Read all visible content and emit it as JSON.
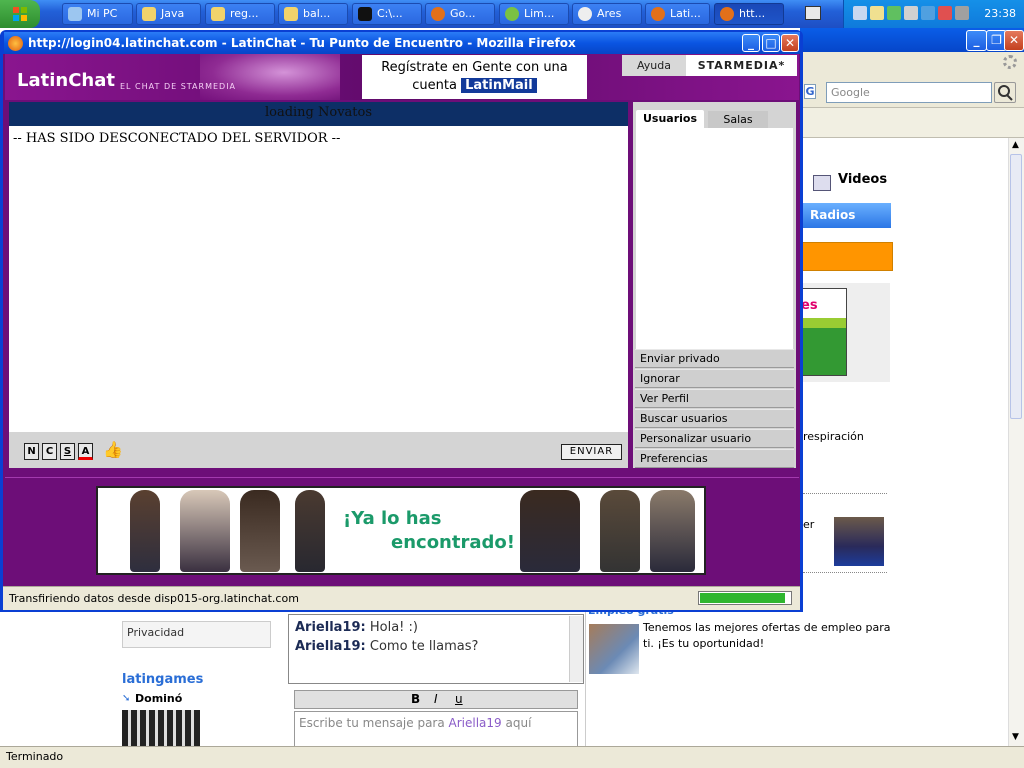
{
  "taskbar": {
    "items": [
      {
        "label": "Mi PC"
      },
      {
        "label": "Java"
      },
      {
        "label": "reg..."
      },
      {
        "label": "bal..."
      },
      {
        "label": "C:\\..."
      },
      {
        "label": "Go..."
      },
      {
        "label": "Lim..."
      },
      {
        "label": "Ares"
      },
      {
        "label": "Lati..."
      },
      {
        "label": "htt..."
      }
    ],
    "clock": "23:38"
  },
  "background_browser": {
    "search_placeholder": "Google",
    "status": "Terminado",
    "videos_label": "Videos",
    "radios_label": "Radios",
    "promo_text": "es",
    "respiracion_text": "respiración",
    "er_text": "er",
    "privacidad": "Privacidad",
    "latingames": "latingames",
    "domino": "Dominó",
    "chat_messages": [
      {
        "nick": "Ariella19:",
        "text": "Hola! :)"
      },
      {
        "nick": "Ariella19:",
        "text": "Como te llamas?"
      }
    ],
    "format_bold": "B",
    "format_italic": "I",
    "format_underline": "u",
    "message_placeholder_prefix": "Escribe tu mensaje para ",
    "message_placeholder_nick": "Ariella19",
    "message_placeholder_suffix": " aquí",
    "empleo_title": "Empleo gratis",
    "empleo_text": "Tenemos las mejores ofertas de empleo para ti. ¡Es tu oportunidad!"
  },
  "popup": {
    "title": "http://login04.latinchat.com - LatinChat - Tu Punto de Encuentro - Mozilla Firefox",
    "logo": "LatinChat",
    "logo_sub": "EL CHAT DE STARMEDIA",
    "register_line1": "Regístrate en Gente con una",
    "register_line2": "cuenta",
    "register_brand": "LatinMail",
    "ayuda": "Ayuda",
    "starmedia": "STARMEDIA*",
    "room_status": "loading Novatos",
    "disconnect_message": "-- HAS SIDO DESCONECTADO DEL SERVIDOR --",
    "format_buttons": [
      "N",
      "C",
      "S",
      "A"
    ],
    "send_label": "ENVIAR",
    "tabs": [
      "Usuarios",
      "Salas"
    ],
    "side_actions": [
      "Enviar privado",
      "Ignorar",
      "Ver Perfil",
      "Buscar usuarios",
      "Personalizar usuario",
      "Preferencias"
    ],
    "banner_line1": "¡Ya lo has",
    "banner_line2": "encontrado!",
    "status_text": "Transfiriendo datos desde disp015-org.latinchat.com",
    "progress": 0.94
  }
}
